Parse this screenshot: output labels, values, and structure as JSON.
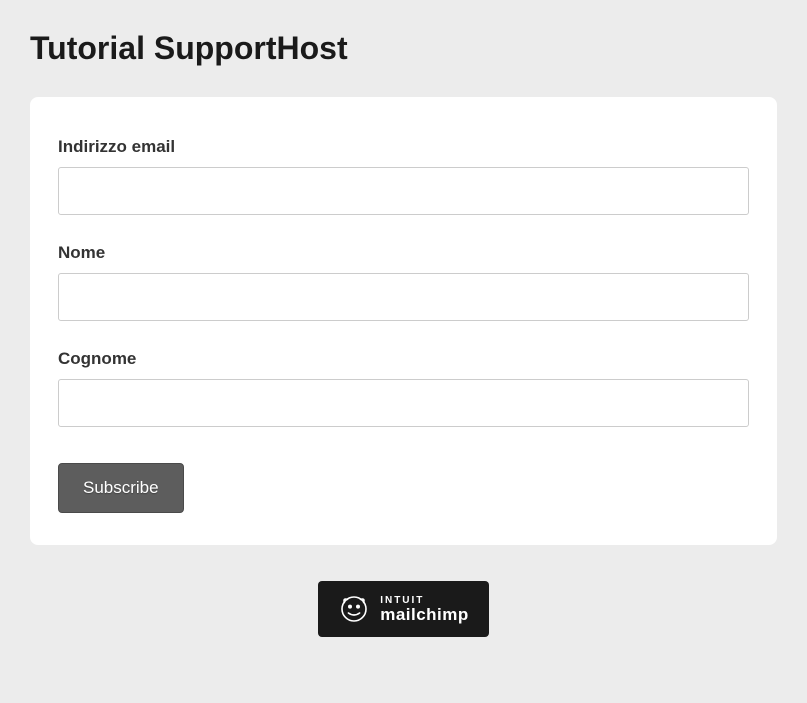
{
  "page": {
    "title": "Tutorial SupportHost"
  },
  "form": {
    "fields": {
      "email": {
        "label": "Indirizzo email",
        "value": ""
      },
      "firstName": {
        "label": "Nome",
        "value": ""
      },
      "lastName": {
        "label": "Cognome",
        "value": ""
      }
    },
    "submitLabel": "Subscribe"
  },
  "footerBadge": {
    "topText": "INTUIT",
    "bottomText": "mailchimp"
  }
}
